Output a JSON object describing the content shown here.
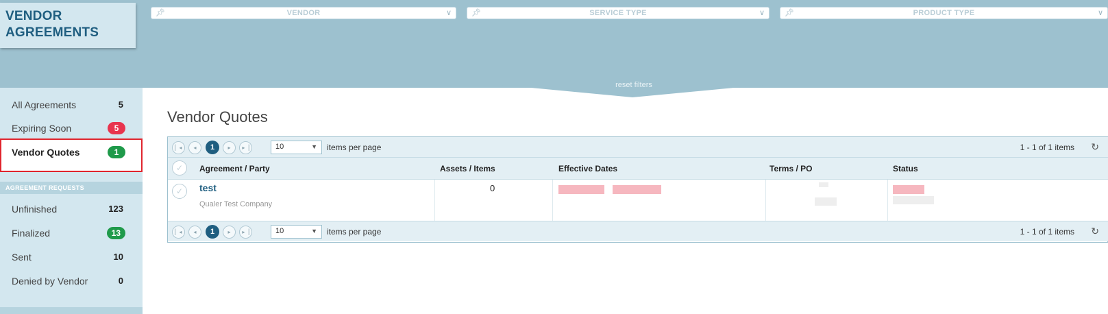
{
  "app": {
    "logo_line1": "VENDOR",
    "logo_line2": "AGREEMENTS"
  },
  "filters": [
    {
      "label": "VENDOR"
    },
    {
      "label": "SERVICE TYPE"
    },
    {
      "label": "PRODUCT TYPE"
    }
  ],
  "reset_label": "reset filters",
  "sidebar": {
    "items": [
      {
        "label": "All Agreements",
        "count": "5"
      },
      {
        "label": "Expiring Soon",
        "count": "5"
      },
      {
        "label": "Vendor Quotes",
        "count": "1"
      }
    ],
    "section_title": "AGREEMENT REQUESTS",
    "requests": [
      {
        "label": "Unfinished",
        "count": "123"
      },
      {
        "label": "Finalized",
        "count": "13"
      },
      {
        "label": "Sent",
        "count": "10"
      },
      {
        "label": "Denied by Vendor",
        "count": "0"
      }
    ]
  },
  "main": {
    "title": "Vendor Quotes",
    "pager": {
      "current_page": "1",
      "page_size": "10",
      "items_per_page_label": "items per page",
      "info": "1 - 1 of 1 items"
    },
    "columns": [
      "Agreement / Party",
      "Assets / Items",
      "Effective Dates",
      "Terms / PO",
      "Status"
    ],
    "rows": [
      {
        "party": "test",
        "company": "Qualer Test Company",
        "assets": "0"
      }
    ]
  },
  "colors": {
    "band": "#9dc1cf",
    "sidebar": "#d3e7ef",
    "brand": "#1f5e80",
    "badge_red": "#e8344e",
    "badge_green": "#1f9a4a",
    "highlight": "#e0242d"
  }
}
